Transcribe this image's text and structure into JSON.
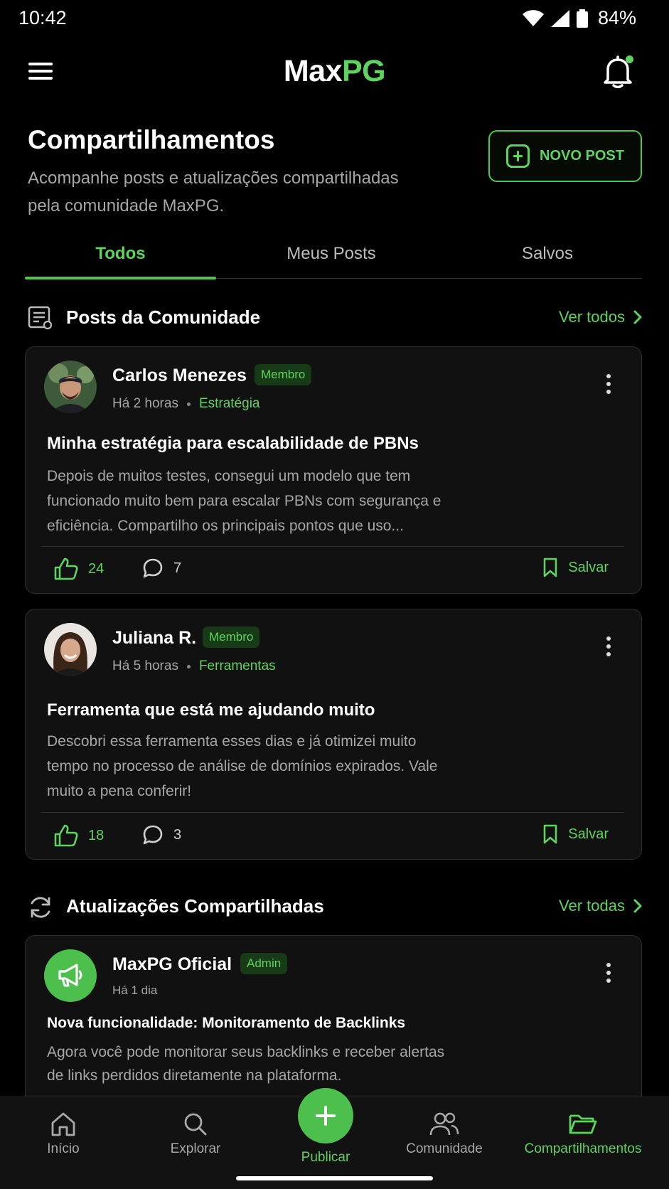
{
  "status_bar": {
    "time": "10:42",
    "battery": "84%"
  },
  "header": {
    "logo_main": "Max",
    "logo_accent": "PG"
  },
  "page": {
    "title": "Compartilhamentos",
    "subtitle": "Acompanhe posts e atualizações compartilhadas pela comunidade MaxPG.",
    "new_post_label": "NOVO POST"
  },
  "tabs": [
    {
      "label": "Todos",
      "active": true
    },
    {
      "label": "Meus Posts",
      "active": false
    },
    {
      "label": "Salvos",
      "active": false
    }
  ],
  "community_section": {
    "title": "Posts da Comunidade",
    "link": "Ver todos",
    "posts": [
      {
        "author": "Carlos Menezes",
        "badge": "Membro",
        "time": "Há 2 horas",
        "category": "Estratégia",
        "title": "Minha estratégia para escalabilidade de PBNs",
        "body": "Depois de muitos testes, consegui um modelo que tem funcionado muito bem para escalar PBNs com segurança e eficiência. Compartilho os principais pontos que uso...",
        "likes": "24",
        "comments": "7",
        "save_label": "Salvar"
      },
      {
        "author": "Juliana R.",
        "badge": "Membro",
        "time": "Há 5 horas",
        "category": "Ferramentas",
        "title": "Ferramenta que está me ajudando muito",
        "body": "Descobri essa ferramenta esses dias e já otimizei muito tempo no processo de análise de domínios expirados. Vale muito a pena conferir!",
        "likes": "18",
        "comments": "3",
        "save_label": "Salvar"
      }
    ]
  },
  "updates_section": {
    "title": "Atualizações Compartilhadas",
    "link": "Ver todas",
    "updates": [
      {
        "author": "MaxPG Oficial",
        "badge": "Admin",
        "time": "Há 1 dia",
        "title": "Nova funcionalidade: Monitoramento de Backlinks",
        "body": "Agora você pode monitorar seus backlinks e receber alertas de links perdidos diretamente na plataforma."
      }
    ]
  },
  "bottom_nav": {
    "items": [
      {
        "label": "Início",
        "icon": "home-icon"
      },
      {
        "label": "Explorar",
        "icon": "search-icon"
      },
      {
        "label": "Publicar",
        "icon": "plus-icon"
      },
      {
        "label": "Comunidade",
        "icon": "users-icon"
      },
      {
        "label": "Compartilhamentos",
        "icon": "folder-icon",
        "active": true
      }
    ]
  },
  "colors": {
    "accent": "#4cc94c",
    "background": "#000000",
    "card": "#111111"
  }
}
